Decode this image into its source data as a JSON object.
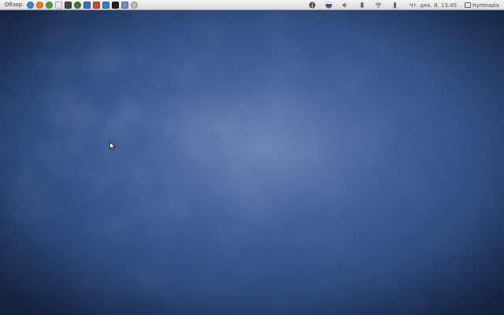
{
  "topbar": {
    "activities_label": "Обзор",
    "launchers": [
      {
        "icon": "pidgin-icon",
        "color": "#3d82d8"
      },
      {
        "icon": "firefox-icon",
        "color": "#e8801e"
      },
      {
        "icon": "chrome-icon",
        "color": "#4c9c36"
      },
      {
        "icon": "home-folder-icon",
        "color": "#e9e9e9"
      },
      {
        "icon": "video-editor-icon",
        "color": "#444444"
      },
      {
        "icon": "media-player-icon",
        "color": "#3a7a3a"
      },
      {
        "icon": "system-monitor-icon",
        "color": "#3b6fb8"
      },
      {
        "icon": "text-editor-icon",
        "color": "#cc4a3a"
      },
      {
        "icon": "document-icon",
        "color": "#3b7cd0"
      },
      {
        "icon": "terminal-icon",
        "color": "#222222"
      },
      {
        "icon": "screenshot-icon",
        "color": "#6b8fc9"
      },
      {
        "icon": "settings-icon",
        "color": "#bdbdbd"
      }
    ],
    "clock": "Чт. дек. 8, 13:45",
    "username": "hymnazix"
  },
  "colors": {
    "wallpaper_center": "#6b82b5",
    "wallpaper_edge": "#13264d"
  }
}
